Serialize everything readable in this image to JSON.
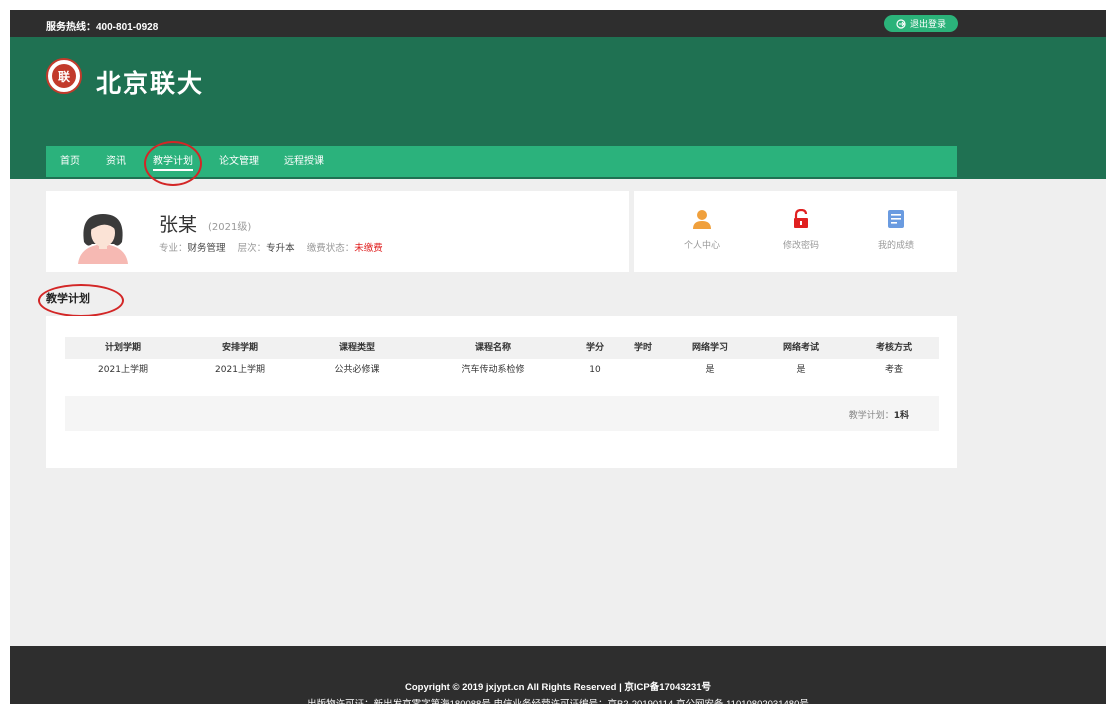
{
  "topbar": {
    "hotline": "服务热线：400-801-0928",
    "logout_label": "退出登录"
  },
  "header": {
    "logo_text": "北京联大",
    "emblem_char": "联"
  },
  "nav": {
    "items": [
      {
        "label": "首页"
      },
      {
        "label": "资讯"
      },
      {
        "label": "教学计划"
      },
      {
        "label": "论文管理"
      },
      {
        "label": "远程授课"
      }
    ],
    "active": "教学计划"
  },
  "profile": {
    "name": "张某",
    "grade": "(2021级)",
    "major_label": "专业：",
    "major": "财务管理",
    "level_label": "层次：",
    "level": "专升本",
    "payment_label": "缴费状态：",
    "payment_status": "未缴费"
  },
  "quick_links": [
    {
      "label": "个人中心",
      "icon": "person-icon"
    },
    {
      "label": "修改密码",
      "icon": "lock-icon"
    },
    {
      "label": "我的成绩",
      "icon": "report-icon"
    }
  ],
  "section": {
    "title": "教学计划"
  },
  "table": {
    "headers": [
      "计划学期",
      "安排学期",
      "课程类型",
      "课程名称",
      "学分",
      "学时",
      "网络学习",
      "网络考试",
      "考核方式"
    ],
    "rows": [
      [
        "2021上学期",
        "2021上学期",
        "公共必修课",
        "汽车传动系检修",
        "10",
        "",
        "是",
        "是",
        "考查"
      ]
    ],
    "summary_label": "教学计划：",
    "summary_value": "1科"
  },
  "footer": {
    "copyright": "Copyright © 2019 jxjypt.cn All Rights Reserved | 京ICP备17043231号",
    "license": "出版物许可证：新出发京零字第海180088号 电信业务经营许可证编号：京B2-20190114 京公网安备 11010802031480号"
  },
  "colors": {
    "header_green": "#1f7152",
    "nav_green": "#2bb27c",
    "accent_orange": "#f0a03c",
    "accent_red": "#e02020",
    "accent_blue": "#6a9be0",
    "dark_bar": "#2e2e2e"
  }
}
